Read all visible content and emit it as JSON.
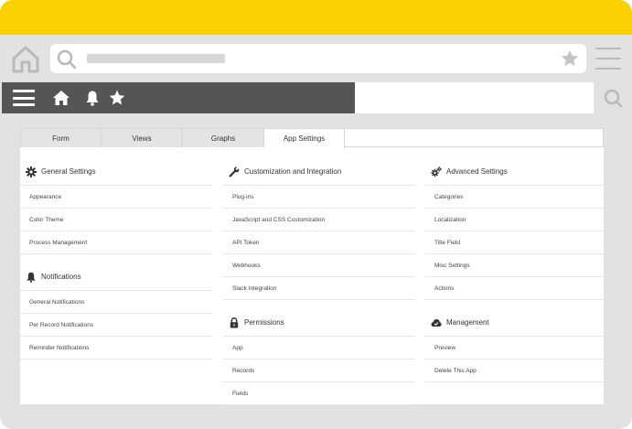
{
  "tabs": [
    {
      "label": "Form"
    },
    {
      "label": "Views"
    },
    {
      "label": "Graphs"
    },
    {
      "label": "App Settings",
      "active": true
    }
  ],
  "columns": [
    {
      "sections": [
        {
          "title": "General Settings",
          "icon": "gear-icon",
          "items": [
            "Appearance",
            "Color Theme",
            "Process Management"
          ]
        },
        {
          "title": "Notifications",
          "icon": "bell-icon",
          "items": [
            "General Notifications",
            "Per Record Notifications",
            "Reminder Notifications"
          ]
        }
      ]
    },
    {
      "sections": [
        {
          "title": "Customization and Integration",
          "icon": "wrench-icon",
          "items": [
            "Plug-ins",
            "JavaScript and CSS Customization",
            "API Token",
            "Webhooks",
            "Slack Integration"
          ]
        },
        {
          "title": "Permissions",
          "icon": "lock-icon",
          "items": [
            "App",
            "Records",
            "Fields"
          ]
        }
      ]
    },
    {
      "sections": [
        {
          "title": "Advanced Settings",
          "icon": "gears-icon",
          "items": [
            "Categories",
            "Localization",
            "Title Field",
            "Misc Settings",
            "Actions"
          ]
        },
        {
          "title": "Management",
          "icon": "cloud-icon",
          "items": [
            "Preview",
            "Delete This App"
          ]
        }
      ]
    }
  ],
  "colors": {
    "top_bar": "#fad000",
    "app_bar": "#555555",
    "frame": "#e2e2e2"
  }
}
